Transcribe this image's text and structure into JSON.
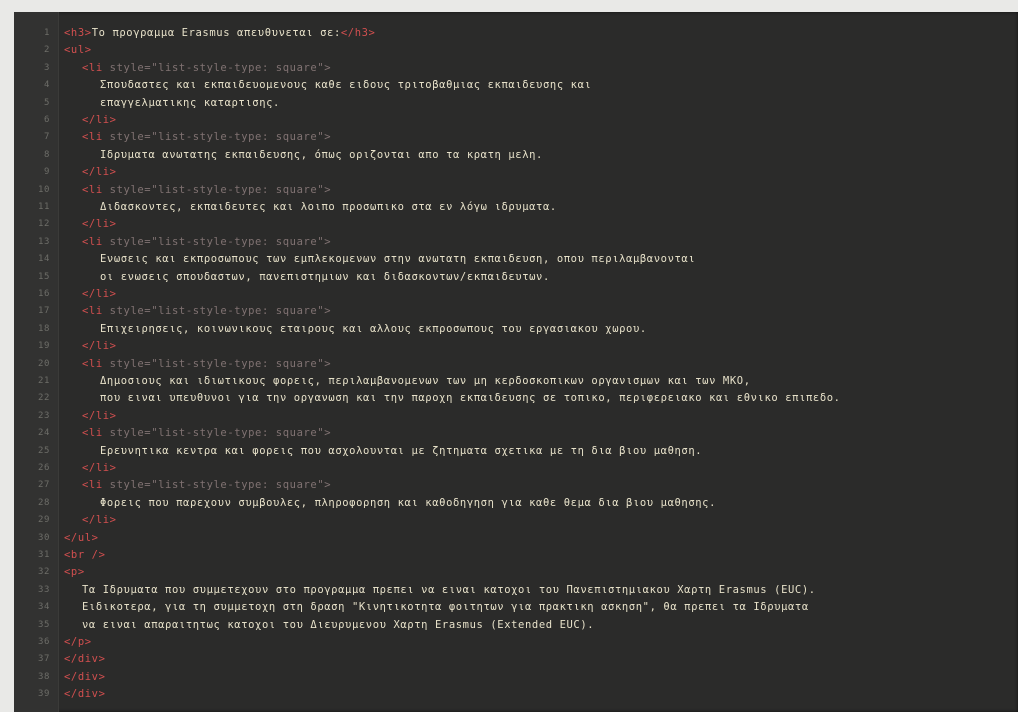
{
  "colors": {
    "background": "#2b2b2a",
    "gutter": "#323231",
    "tag": "#d14f4f",
    "attribute": "#9d8a8a",
    "text": "#e7e1c9",
    "line_number": "#6d6d68"
  },
  "editor": {
    "lines": [
      {
        "num": "1",
        "tag_open": "<h3>",
        "text": "Το προγραμμα Erasmus απευθυνεται σε:",
        "tag_close": "</h3>",
        "indent": 0
      },
      {
        "num": "2",
        "tag_open": "<ul>",
        "text": "",
        "tag_close": "",
        "indent": 0
      },
      {
        "num": "3",
        "tag_open": "<li",
        "attr": " style=\"list-style-type: square\">",
        "text": "",
        "tag_close": "",
        "indent": 1
      },
      {
        "num": "4",
        "tag_open": "",
        "text": "Σπουδαστες και εκπαιδευομενους καθε ειδους τριτοβαθμιας εκπαιδευσης και",
        "tag_close": "",
        "indent": 2
      },
      {
        "num": "5",
        "tag_open": "",
        "text": "επαγγελματικης καταρτισης.",
        "tag_close": "",
        "indent": 2
      },
      {
        "num": "6",
        "tag_open": "</li>",
        "text": "",
        "tag_close": "",
        "indent": 1
      },
      {
        "num": "7",
        "tag_open": "<li",
        "attr": " style=\"list-style-type: square\">",
        "text": "",
        "tag_close": "",
        "indent": 1
      },
      {
        "num": "8",
        "tag_open": "",
        "text": "Ιδρυματα ανωτατης εκπαιδευσης, όπως οριζονται απο τα κρατη μελη.",
        "tag_close": "",
        "indent": 2
      },
      {
        "num": "9",
        "tag_open": "</li>",
        "text": "",
        "tag_close": "",
        "indent": 1
      },
      {
        "num": "10",
        "tag_open": "<li",
        "attr": " style=\"list-style-type: square\">",
        "text": "",
        "tag_close": "",
        "indent": 1
      },
      {
        "num": "11",
        "tag_open": "",
        "text": "Διδασκοντες, εκπαιδευτες και λοιπο προσωπικο στα εν λόγω ιδρυματα.",
        "tag_close": "",
        "indent": 2
      },
      {
        "num": "12",
        "tag_open": "</li>",
        "text": "",
        "tag_close": "",
        "indent": 1
      },
      {
        "num": "13",
        "tag_open": "<li",
        "attr": " style=\"list-style-type: square\">",
        "text": "",
        "tag_close": "",
        "indent": 1
      },
      {
        "num": "14",
        "tag_open": "",
        "text": "Ενωσεις και εκπροσωπους των εμπλεκομενων στην ανωτατη εκπαιδευση, οπου περιλαμβανονται",
        "tag_close": "",
        "indent": 2
      },
      {
        "num": "15",
        "tag_open": "",
        "text": "οι ενωσεις σπουδαστων, πανεπιστημιων και διδασκοντων/εκπαιδευτων.",
        "tag_close": "",
        "indent": 2
      },
      {
        "num": "16",
        "tag_open": "</li>",
        "text": "",
        "tag_close": "",
        "indent": 1
      },
      {
        "num": "17",
        "tag_open": "<li",
        "attr": " style=\"list-style-type: square\">",
        "text": "",
        "tag_close": "",
        "indent": 1
      },
      {
        "num": "18",
        "tag_open": "",
        "text": "Επιχειρησεις, κοινωνικους εταιρους και αλλους εκπροσωπους του εργασιακου χωρου.",
        "tag_close": "",
        "indent": 2
      },
      {
        "num": "19",
        "tag_open": "</li>",
        "text": "",
        "tag_close": "",
        "indent": 1
      },
      {
        "num": "20",
        "tag_open": "<li",
        "attr": " style=\"list-style-type: square\">",
        "text": "",
        "tag_close": "",
        "indent": 1
      },
      {
        "num": "21",
        "tag_open": "",
        "text": "Δημοσιους και ιδιωτικους φορεις, περιλαμβανομενων των μη κερδοσκοπικων οργανισμων και των ΜΚΟ,",
        "tag_close": "",
        "indent": 2
      },
      {
        "num": "22",
        "tag_open": "",
        "text": "που ειναι υπευθυνοι για την οργανωση και την παροχη εκπαιδευσης σε τοπικο, περιφερειακο και εθνικο επιπεδο.",
        "tag_close": "",
        "indent": 2
      },
      {
        "num": "23",
        "tag_open": "</li>",
        "text": "",
        "tag_close": "",
        "indent": 1
      },
      {
        "num": "24",
        "tag_open": "<li",
        "attr": " style=\"list-style-type: square\">",
        "text": "",
        "tag_close": "",
        "indent": 1
      },
      {
        "num": "25",
        "tag_open": "",
        "text": "Ερευνητικα κεντρα και φορεις που ασχολουνται με ζητηματα σχετικα με τη δια βιου μαθηση.",
        "tag_close": "",
        "indent": 2
      },
      {
        "num": "26",
        "tag_open": "</li>",
        "text": "",
        "tag_close": "",
        "indent": 1
      },
      {
        "num": "27",
        "tag_open": "<li",
        "attr": " style=\"list-style-type: square\">",
        "text": "",
        "tag_close": "",
        "indent": 1
      },
      {
        "num": "28",
        "tag_open": "",
        "text": "Φορεις που παρεχουν συμβουλες, πληροφορηση και καθοδηγηση για καθε θεμα δια βιου μαθησης.",
        "tag_close": "",
        "indent": 2
      },
      {
        "num": "29",
        "tag_open": "</li>",
        "text": "",
        "tag_close": "",
        "indent": 1
      },
      {
        "num": "30",
        "tag_open": "</ul>",
        "text": "",
        "tag_close": "",
        "indent": 0
      },
      {
        "num": "31",
        "tag_open": "<br />",
        "text": "",
        "tag_close": "",
        "indent": 0
      },
      {
        "num": "32",
        "tag_open": "<p>",
        "text": "",
        "tag_close": "",
        "indent": 0
      },
      {
        "num": "33",
        "tag_open": "",
        "text": "Τα Ιδρυματα που συμμετεχουν στο προγραμμα πρεπει να ειναι κατοχοι του Πανεπιστημιακου Χαρτη Erasmus (EUC).",
        "tag_close": "",
        "indent": 1
      },
      {
        "num": "34",
        "tag_open": "",
        "text": "Ειδικοτερα, για τη συμμετοχη στη δραση \"Κινητικοτητα φοιτητων για πρακτικη ασκηση\", θα πρεπει τα Ιδρυματα",
        "tag_close": "",
        "indent": 1
      },
      {
        "num": "35",
        "tag_open": "",
        "text": "να ειναι απαραιτητως κατοχοι του Διευρυμενου Χαρτη Erasmus (Extended EUC).",
        "tag_close": "",
        "indent": 1
      },
      {
        "num": "36",
        "tag_open": "</p>",
        "text": "",
        "tag_close": "",
        "indent": 0
      },
      {
        "num": "37",
        "tag_open": "</div>",
        "text": "",
        "tag_close": "",
        "indent": 0
      },
      {
        "num": "38",
        "tag_open": "</div>",
        "text": "",
        "tag_close": "",
        "indent": 0
      },
      {
        "num": "39",
        "tag_open": "</div>",
        "text": "",
        "tag_close": "",
        "indent": 0
      }
    ]
  }
}
